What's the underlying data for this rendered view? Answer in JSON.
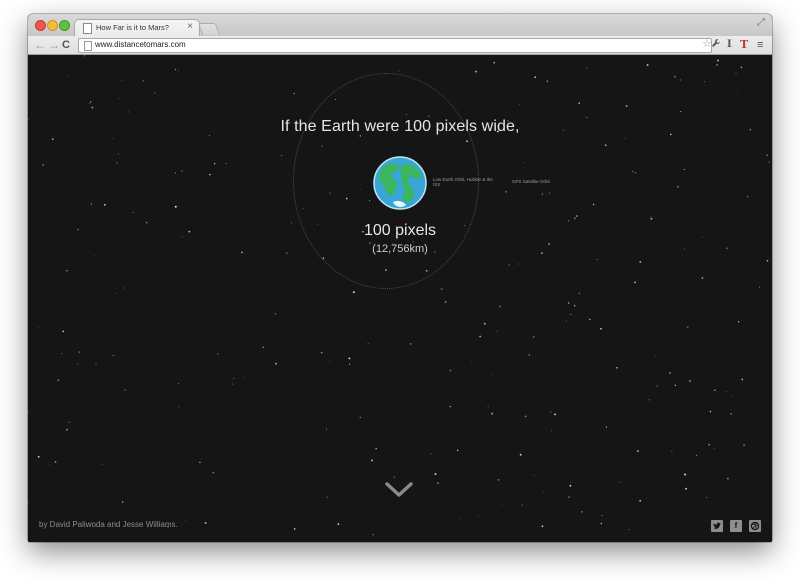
{
  "browser": {
    "tab_title": "How Far is it to Mars?",
    "tab_close": "×",
    "url": "www.distancetomars.com",
    "icons": [
      "back-arrow-icon",
      "forward-arrow-icon",
      "reload-icon",
      "star-icon",
      "wrench-icon",
      "extension-i-icon",
      "extension-t-icon",
      "menu-icon",
      "fullscreen-icon"
    ]
  },
  "page": {
    "headline": "If the Earth were 100 pixels wide,",
    "leo_label": "Low Earth Orbit, Hubble & the ISS",
    "gps_label": "GPS Satellite Orbit",
    "size": "100 pixels",
    "size_km": "(12,756km)",
    "credits": "by David Paliwoda and Jesse Williams.",
    "social_icons": [
      "twitter-icon",
      "facebook-icon",
      "dribbble-icon"
    ],
    "colors": {
      "background": "#151515",
      "text": "#e6e6e6",
      "ocean": "#3aa6d8",
      "land": "#3cb560"
    }
  }
}
